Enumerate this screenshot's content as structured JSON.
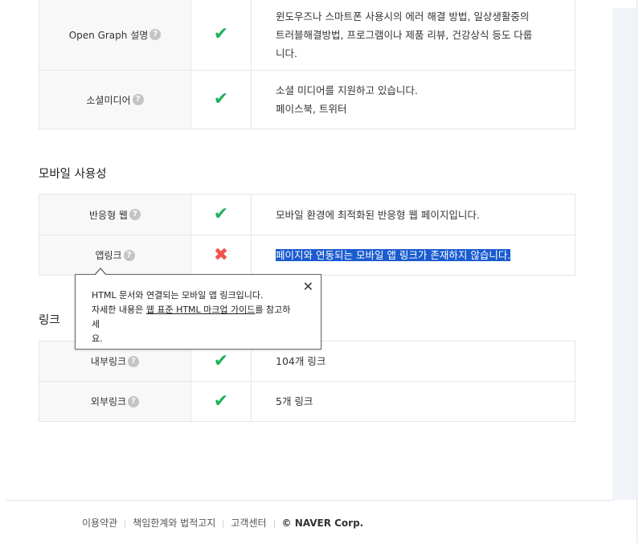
{
  "meta_section": {
    "rows": [
      {
        "label": "Open Graph 설명",
        "status": "check",
        "desc_lines": [
          "윈도우즈나 스마트폰 사용시의 에러 해결 방법, 일상생활중의",
          "트러블해결방법, 프로그램이나 제품 리뷰, 건강상식 등도 다룹",
          "니다."
        ]
      },
      {
        "label": "소셜미디어",
        "status": "check",
        "desc_lines": [
          "소셜 미디어를 지원하고 있습니다.",
          "페이스북, 트위터"
        ]
      }
    ]
  },
  "mobile_section": {
    "title": "모바일 사용성",
    "rows": [
      {
        "label": "반응형 웹",
        "status": "check",
        "desc": "모바일 환경에 최적화된 반응형 웹 페이지입니다."
      },
      {
        "label": "앱링크",
        "status": "cross",
        "desc": "페이지와 연동되는 모바일 앱 링크가 존재하지 않습니다."
      }
    ]
  },
  "links_section": {
    "title": "링크",
    "rows": [
      {
        "label": "내부링크",
        "status": "check",
        "desc": "104개 링크"
      },
      {
        "label": "외부링크",
        "status": "check",
        "desc": "5개 링크"
      }
    ]
  },
  "tooltip": {
    "line1": "HTML 문서와 연결되는 모바일 앱 링크입니다.",
    "line2_prefix": "자세한 내용은 ",
    "link_text": "웹 표준 HTML 마크업 가이드",
    "line2_suffix": "를 참고하세",
    "line3": "요.",
    "close": "✕"
  },
  "icons": {
    "help": "?",
    "check": "✔",
    "cross": "✖"
  },
  "footer": {
    "terms": "이용약관",
    "liability": "책임한계와 법적고지",
    "support": "고객센터",
    "corp": "© NAVER Corp."
  }
}
